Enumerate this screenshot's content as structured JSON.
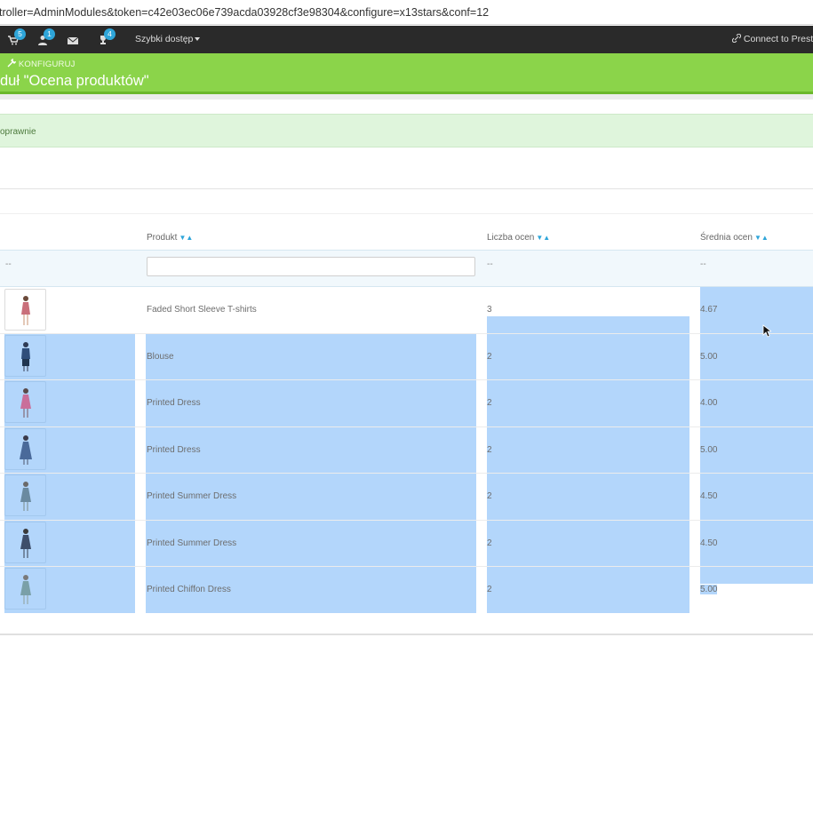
{
  "browser": {
    "url": "troller=AdminModules&token=c42e03ec06e739acda03928cf3e98304&configure=x13stars&conf=12"
  },
  "topnav": {
    "badges": {
      "orders": "5",
      "customers": "1",
      "messages": "",
      "trophy": "4"
    },
    "quick_access": "Szybki dostęp",
    "connect": "Connect to Prest"
  },
  "header": {
    "breadcrumb": "KONFIGURUJ",
    "title": "duł \"Ocena produktów\""
  },
  "alert": {
    "text": "oprawnie"
  },
  "table": {
    "columns": {
      "product": "Produkt",
      "count": "Liczba ocen",
      "average": "Średnia ocen"
    },
    "filter_placeholder_dash": "--",
    "rows": [
      {
        "product": "Faded Short Sleeve T-shirts",
        "count": "3",
        "average": "4.67",
        "thumb_color": "#c96f7a",
        "selected": false
      },
      {
        "product": "Blouse",
        "count": "2",
        "average": "5.00",
        "thumb_color": "#2f4e7a",
        "selected": true
      },
      {
        "product": "Printed Dress",
        "count": "2",
        "average": "4.00",
        "thumb_color": "#c96f9a",
        "selected": true
      },
      {
        "product": "Printed Dress",
        "count": "2",
        "average": "5.00",
        "thumb_color": "#4a6a9a",
        "selected": true
      },
      {
        "product": "Printed Summer Dress",
        "count": "2",
        "average": "4.50",
        "thumb_color": "#6a8aa0",
        "selected": true
      },
      {
        "product": "Printed Summer Dress",
        "count": "2",
        "average": "4.50",
        "thumb_color": "#3e4e6a",
        "selected": true
      },
      {
        "product": "Printed Chiffon Dress",
        "count": "2",
        "average": "5.00",
        "thumb_color": "#7aa0a8",
        "selected": true
      }
    ]
  },
  "colors": {
    "nav_bg": "#2a2a2a",
    "green_header": "#8bd44a",
    "selection": "#b3d6fb",
    "badge": "#2ea5d9"
  }
}
